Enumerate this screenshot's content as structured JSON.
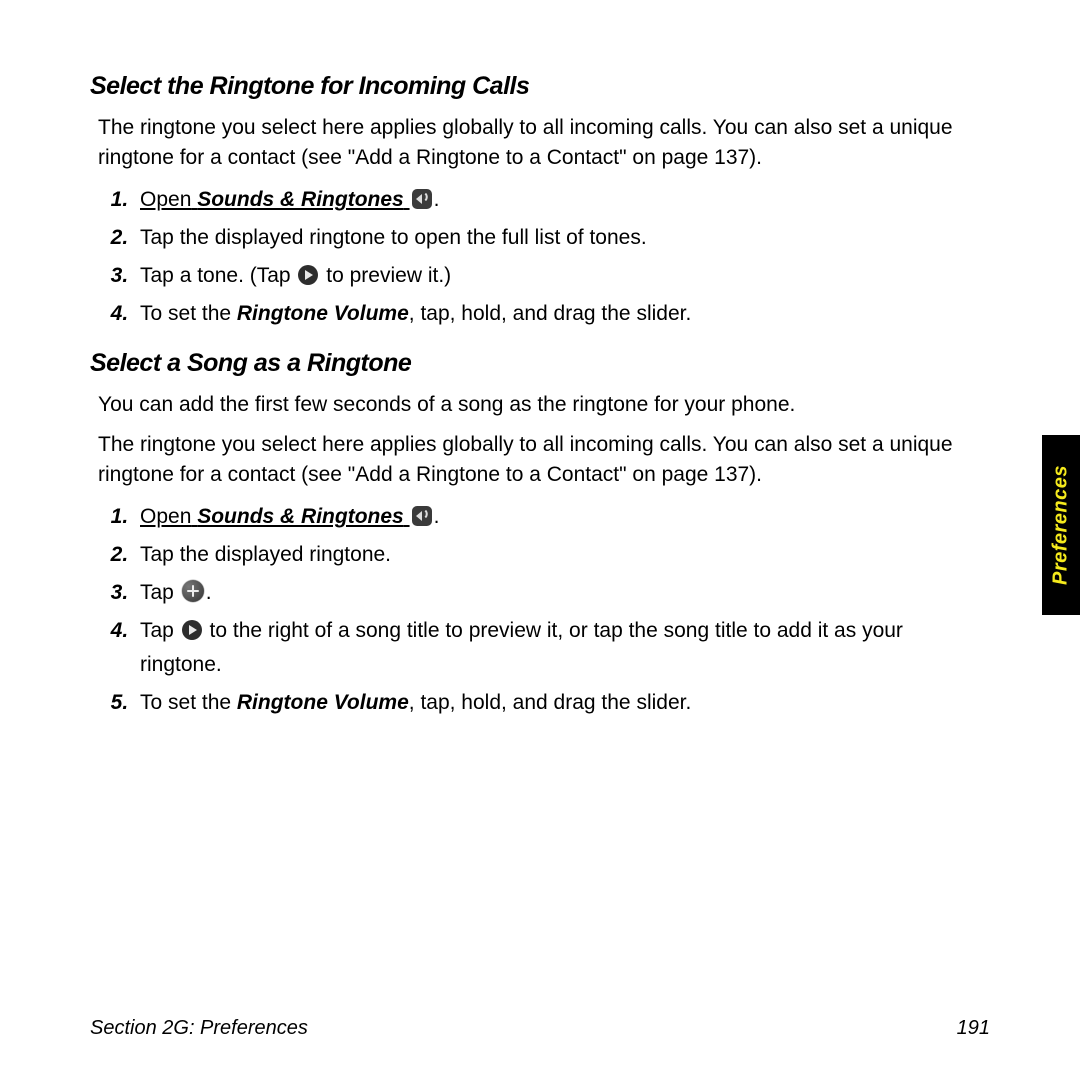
{
  "section1": {
    "heading": "Select the Ringtone for Incoming Calls",
    "intro": "The ringtone you select here applies globally to all incoming calls. You can also set a unique ringtone for a contact (see \"Add a Ringtone to a Contact\" on page 137).",
    "steps": {
      "s1_open": "Open",
      "s1_app": "Sounds & Ringtones",
      "s1_period": ".",
      "s2": "Tap the displayed ringtone to open the full list of tones.",
      "s3a": "Tap a tone. (Tap ",
      "s3b": " to preview it.)",
      "s4a": "To set the ",
      "s4_bold": "Ringtone Volume",
      "s4b": ", tap, hold, and drag the slider."
    }
  },
  "section2": {
    "heading": "Select a Song as a Ringtone",
    "intro1": "You can add the first few seconds of a song as the ringtone for your phone.",
    "intro2": "The ringtone you select here applies globally to all incoming calls. You can also set a unique ringtone for a contact (see \"Add a Ringtone to a Contact\" on page 137).",
    "steps": {
      "s1_open": "Open",
      "s1_app": "Sounds & Ringtones",
      "s1_period": ".",
      "s2": "Tap the displayed ringtone.",
      "s3a": "Tap ",
      "s3_period": ".",
      "s4a": "Tap ",
      "s4b": " to the right of a song title to preview it, or tap the song title to add it as your ringtone.",
      "s5a": "To set the ",
      "s5_bold": "Ringtone Volume",
      "s5b": ", tap, hold, and drag the slider."
    }
  },
  "sidetab": "Preferences",
  "footer": {
    "section": "Section 2G: Preferences",
    "page": "191"
  }
}
